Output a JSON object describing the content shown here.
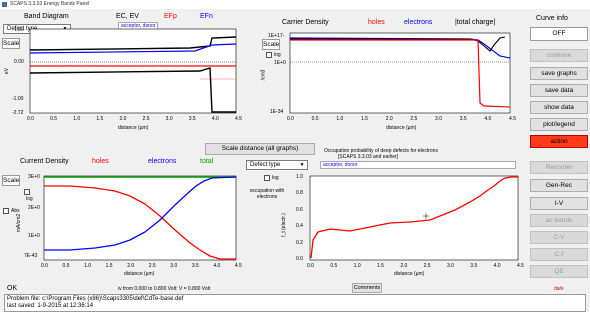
{
  "window": {
    "title": "SCAPS 3.3.03 Energy Bands Panel"
  },
  "band": {
    "title": "Band Diagram",
    "legend_ec_ev": "EC, EV",
    "legend_efp": "EFp",
    "legend_efn": "EFn",
    "tag": "acceptor, donor",
    "defect_select": "Defect type",
    "scale_label": "Scale",
    "ylabel": "eV",
    "xlabel": "distance (µm)",
    "yticks": [
      "1.29",
      "0.00",
      "-1.00",
      "-2.72"
    ],
    "xticks": [
      "0.0",
      "0.5",
      "1.0",
      "1.5",
      "2.0",
      "2.5",
      "3.0",
      "3.5",
      "4.0",
      "4.5"
    ]
  },
  "carrier": {
    "title": "Carrier Density",
    "legend_holes": "holes",
    "legend_electrons": "electrons",
    "legend_total": "|total charge|",
    "scale_label": "Scale",
    "log_label": "log",
    "ylabel": "/cm3",
    "xlabel": "distance (µm)",
    "yticks": [
      "1E+17-",
      "1E+0",
      "1E-34"
    ],
    "xticks": [
      "0.0",
      "0.5",
      "1.0",
      "1.5",
      "2.0",
      "2.5",
      "3.0",
      "3.5",
      "4.0",
      "4.5"
    ]
  },
  "current": {
    "title": "Current Density",
    "legend_holes": "holes",
    "legend_electrons": "electrons",
    "legend_total": "total",
    "scale_label": "Scale",
    "log_label": "log",
    "abs_label": "Abs",
    "ylabel": "mA/cm2",
    "xlabel": "distance (µm)",
    "yticks": [
      "3E+0",
      "2E+0",
      "1E+0",
      "7E-43"
    ],
    "xticks": [
      "0.0",
      "0.5",
      "1.0",
      "1.5",
      "2.0",
      "2.5",
      "3.0",
      "3.5",
      "4.0",
      "4.5"
    ]
  },
  "defect": {
    "title": "Occupation probability of deep defects for electrons",
    "subtitle": "[SCAPS 3.3.03 and earlier]",
    "tag": "acceptor, donor",
    "defect_select": "Defect type",
    "occupation_label": "occupation with electrons",
    "log_label": "log",
    "ylabel": "f_t (electr.)",
    "xlabel": "distance (µm)",
    "yticks": [
      "1.0",
      "0.8",
      "0.6",
      "0.4",
      "0.2",
      "0.0"
    ],
    "xticks": [
      "0.0",
      "0.5",
      "1.0",
      "1.5",
      "2.0",
      "2.5",
      "3.0",
      "3.5",
      "4.0",
      "4.5"
    ]
  },
  "scale_distance_button": "Scale distance (all graphs)",
  "sidebar": {
    "curve_info": "Curve info",
    "off": "OFF",
    "continue": "continue",
    "save_graphs": "save graphs",
    "save_data": "save data",
    "show_data": "show data",
    "plot_legend": "plot/legend",
    "action": "action",
    "recorder": "Recorder",
    "gen_rec": "Gen-Rec",
    "iv": "I-V",
    "ac_bands": "ac bands",
    "cv": "C-V",
    "cf": "C-f",
    "qe": "QE"
  },
  "status": {
    "ok": "OK",
    "bias": "iv from 0.000 to 0.800 Volt: V =  0.800 Volt",
    "comments": "Comments",
    "dark": "dark",
    "problem_file": "Problem file: c:\\Program Files (x86)\\Scaps3305\\def\\CdTe-base.def",
    "last_saved": "last saved: 1-9-2015 at 12:36:14"
  },
  "colors": {
    "holes": "#ff0000",
    "electrons": "#0000ff",
    "total": "#00a000",
    "action": "#ff3b1a"
  }
}
